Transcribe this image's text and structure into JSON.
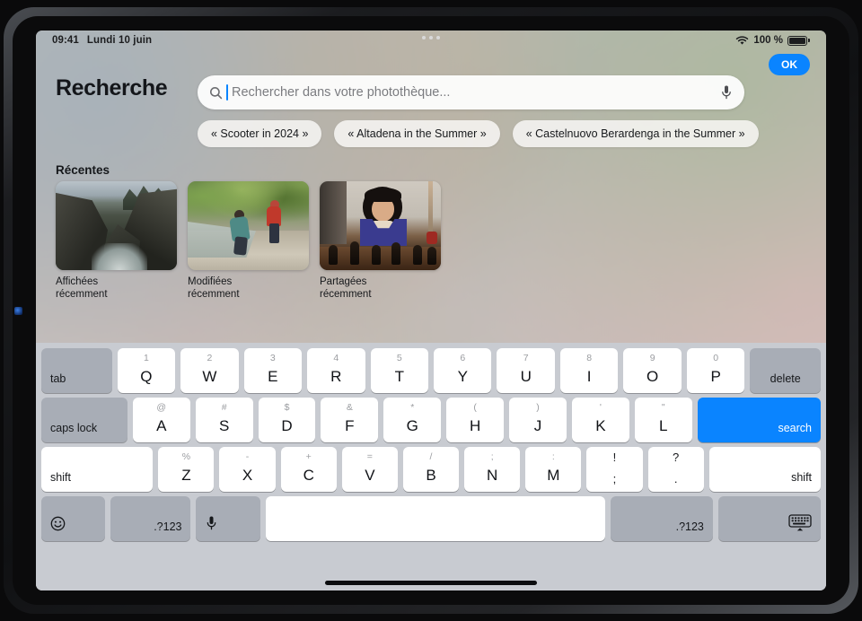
{
  "statusbar": {
    "time": "09:41",
    "date": "Lundi 10 juin",
    "battery_percent": "100 %",
    "wifi_icon": "wifi-icon",
    "battery_icon": "battery-icon",
    "multitask_icon": "multitasking-dots-icon"
  },
  "ok_button": {
    "label": "OK"
  },
  "header": {
    "title": "Recherche"
  },
  "search": {
    "placeholder": "Rechercher dans votre photothèque...",
    "value": "",
    "search_icon": "search-icon",
    "mic_icon": "microphone-icon"
  },
  "suggestions": [
    {
      "label": "« Scooter in 2024 »"
    },
    {
      "label": "« Altadena in the Summer »"
    },
    {
      "label": "« Castelnuovo Berardenga in the Summer »"
    }
  ],
  "recents": {
    "heading": "Récentes",
    "items": [
      {
        "caption": "Affichées\nrécemment",
        "caption_line1": "Affichées",
        "caption_line2": "récemment",
        "photo": "coastal-cliffs-photo"
      },
      {
        "caption": "Modifiées\nrécemment",
        "caption_line1": "Modifiées",
        "caption_line2": "récemment",
        "photo": "creek-hikers-photo"
      },
      {
        "caption": "Partagées\nrécemment",
        "caption_line1": "Partagées",
        "caption_line2": "récemment",
        "photo": "girl-chess-photo"
      }
    ]
  },
  "keyboard": {
    "row1": {
      "tab": "tab",
      "keys": [
        {
          "alt": "1",
          "main": "Q"
        },
        {
          "alt": "2",
          "main": "W"
        },
        {
          "alt": "3",
          "main": "E"
        },
        {
          "alt": "4",
          "main": "R"
        },
        {
          "alt": "5",
          "main": "T"
        },
        {
          "alt": "6",
          "main": "Y"
        },
        {
          "alt": "7",
          "main": "U"
        },
        {
          "alt": "8",
          "main": "I"
        },
        {
          "alt": "9",
          "main": "O"
        },
        {
          "alt": "0",
          "main": "P"
        }
      ],
      "delete": "delete"
    },
    "row2": {
      "caps_lock": "caps lock",
      "keys": [
        {
          "alt": "@",
          "main": "A"
        },
        {
          "alt": "#",
          "main": "S"
        },
        {
          "alt": "$",
          "main": "D"
        },
        {
          "alt": "&",
          "main": "F"
        },
        {
          "alt": "*",
          "main": "G"
        },
        {
          "alt": "(",
          "main": "H"
        },
        {
          "alt": ")",
          "main": "J"
        },
        {
          "alt": "'",
          "main": "K"
        },
        {
          "alt": "\"",
          "main": "L"
        }
      ],
      "search": "search"
    },
    "row3": {
      "shift_left": "shift",
      "keys": [
        {
          "alt": "%",
          "main": "Z"
        },
        {
          "alt": "-",
          "main": "X"
        },
        {
          "alt": "+",
          "main": "C"
        },
        {
          "alt": "=",
          "main": "V"
        },
        {
          "alt": "/",
          "main": "B"
        },
        {
          "alt": ";",
          "main": "N"
        },
        {
          "alt": ":",
          "main": "M"
        }
      ],
      "sym_keys": [
        {
          "alt": "!",
          "main": ";"
        },
        {
          "alt": "?",
          "main": "."
        }
      ],
      "shift_right": "shift"
    },
    "row4": {
      "emoji_icon": "emoji-smiley-icon",
      "numbers_left": ".?123",
      "dictation_icon": "microphone-icon",
      "space": "",
      "numbers_right": ".?123",
      "dismiss_icon": "hide-keyboard-icon"
    }
  },
  "colors": {
    "accent_blue": "#0a84ff",
    "keyboard_bg": "#c8cbd1",
    "key_white": "#ffffff",
    "key_gray": "#a8adb6"
  }
}
